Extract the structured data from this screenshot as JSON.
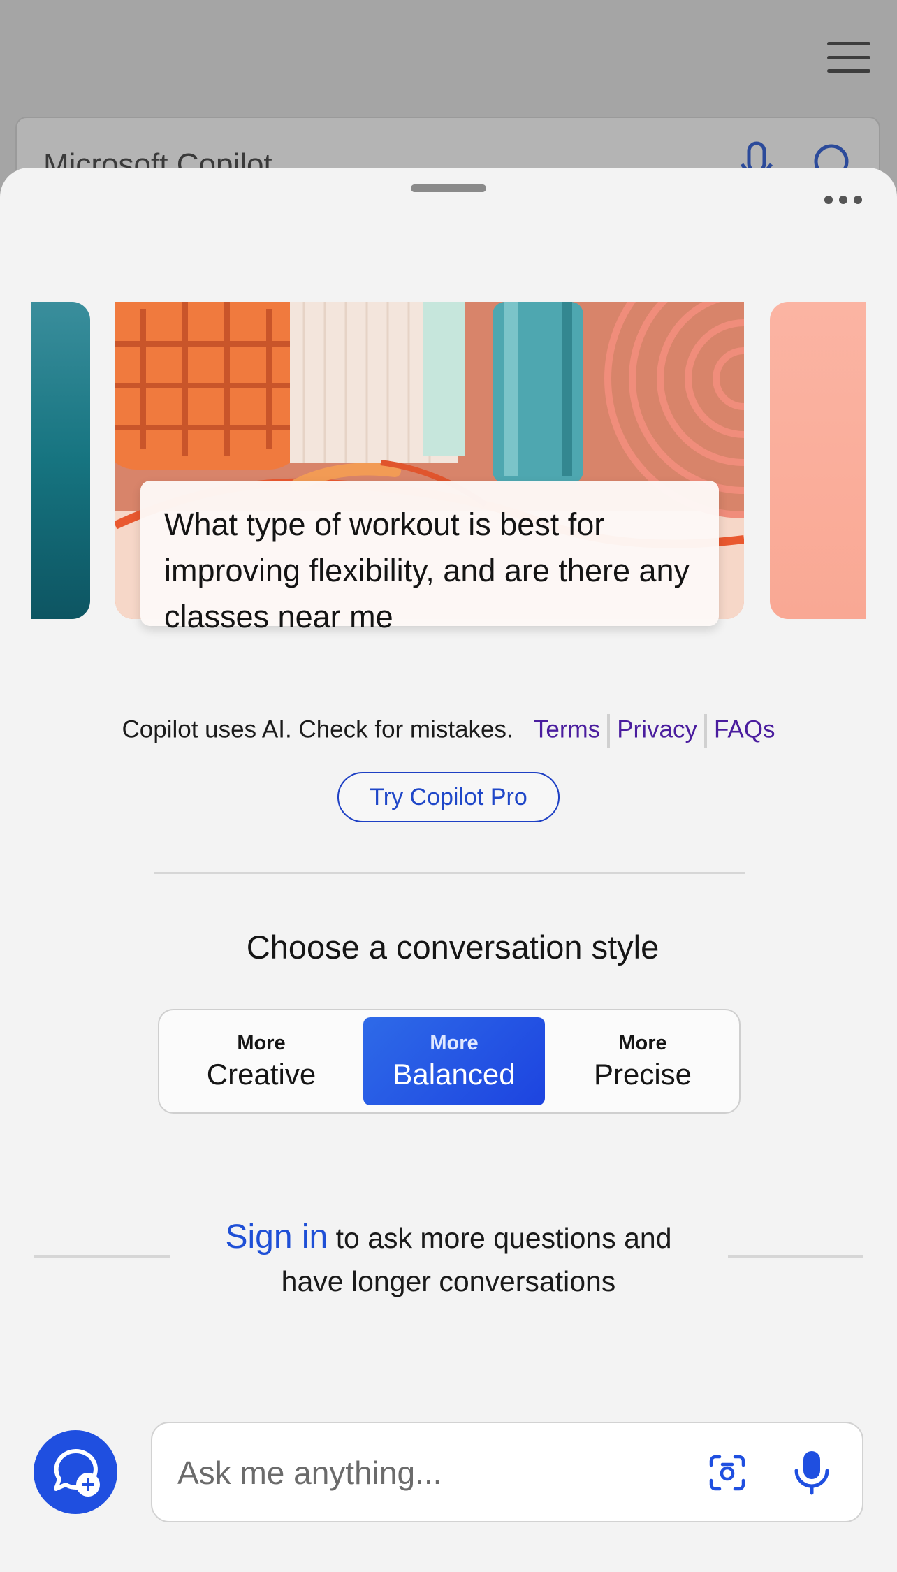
{
  "background": {
    "search_text": "Microsoft Copilot"
  },
  "carousel": {
    "prompt": "What type of workout is best for improving flexibility, and are there any classes near me"
  },
  "legal": {
    "text": "Copilot uses AI. Check for mistakes.",
    "terms": "Terms",
    "privacy": "Privacy",
    "faqs": "FAQs"
  },
  "pro_button": "Try Copilot Pro",
  "conversation_style": {
    "title": "Choose a conversation style",
    "options": [
      {
        "small": "More",
        "label": "Creative",
        "selected": false
      },
      {
        "small": "More",
        "label": "Balanced",
        "selected": true
      },
      {
        "small": "More",
        "label": "Precise",
        "selected": false
      }
    ]
  },
  "signin": {
    "link": "Sign in",
    "text_line1": " to ask more questions and",
    "text_line2": "have longer conversations"
  },
  "input": {
    "placeholder": "Ask me anything..."
  },
  "colors": {
    "accent": "#1f4fe0",
    "link_purple": "#4a1d9e",
    "sheet_bg": "#f3f3f3"
  }
}
